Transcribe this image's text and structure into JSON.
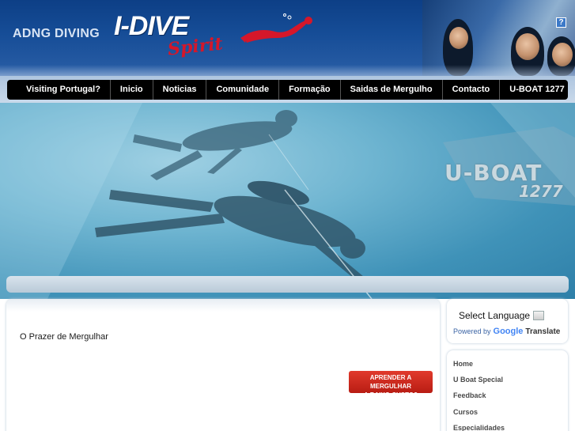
{
  "header": {
    "brand_small": "ADNG DIVING",
    "brand_logo": "I-DIVE",
    "brand_script": "Spirit",
    "help_icon": "?"
  },
  "nav": {
    "items": [
      {
        "label": "Visiting Portugal?"
      },
      {
        "label": "Inicio"
      },
      {
        "label": "Noticias"
      },
      {
        "label": "Comunidade"
      },
      {
        "label": "Formação"
      },
      {
        "label": "Saidas de Mergulho"
      },
      {
        "label": "Contacto"
      },
      {
        "label": "U-BOAT 1277"
      }
    ]
  },
  "banner": {
    "title": "U-BOAT",
    "number": "1277"
  },
  "main": {
    "text": "O Prazer de Mergulhar",
    "cta_line1": "APRENDER A MERGULHAR",
    "cta_line2": "A BAIXO CUSTO?"
  },
  "sidebar": {
    "select_language": "Select Language",
    "powered_by": "Powered by",
    "google": "Google",
    "translate": "Translate",
    "menu": [
      {
        "label": "Home"
      },
      {
        "label": "U Boat Special"
      },
      {
        "label": "Feedback"
      },
      {
        "label": "Cursos"
      },
      {
        "label": "Especialidades"
      }
    ]
  },
  "colors": {
    "header_blue": "#164d97",
    "nav_black": "#000000",
    "cta_red": "#d12a1e",
    "logo_red": "#d5172a"
  },
  "icons": [
    "help-icon",
    "dropdown-arrow-icon",
    "diver-logo-icon"
  ]
}
